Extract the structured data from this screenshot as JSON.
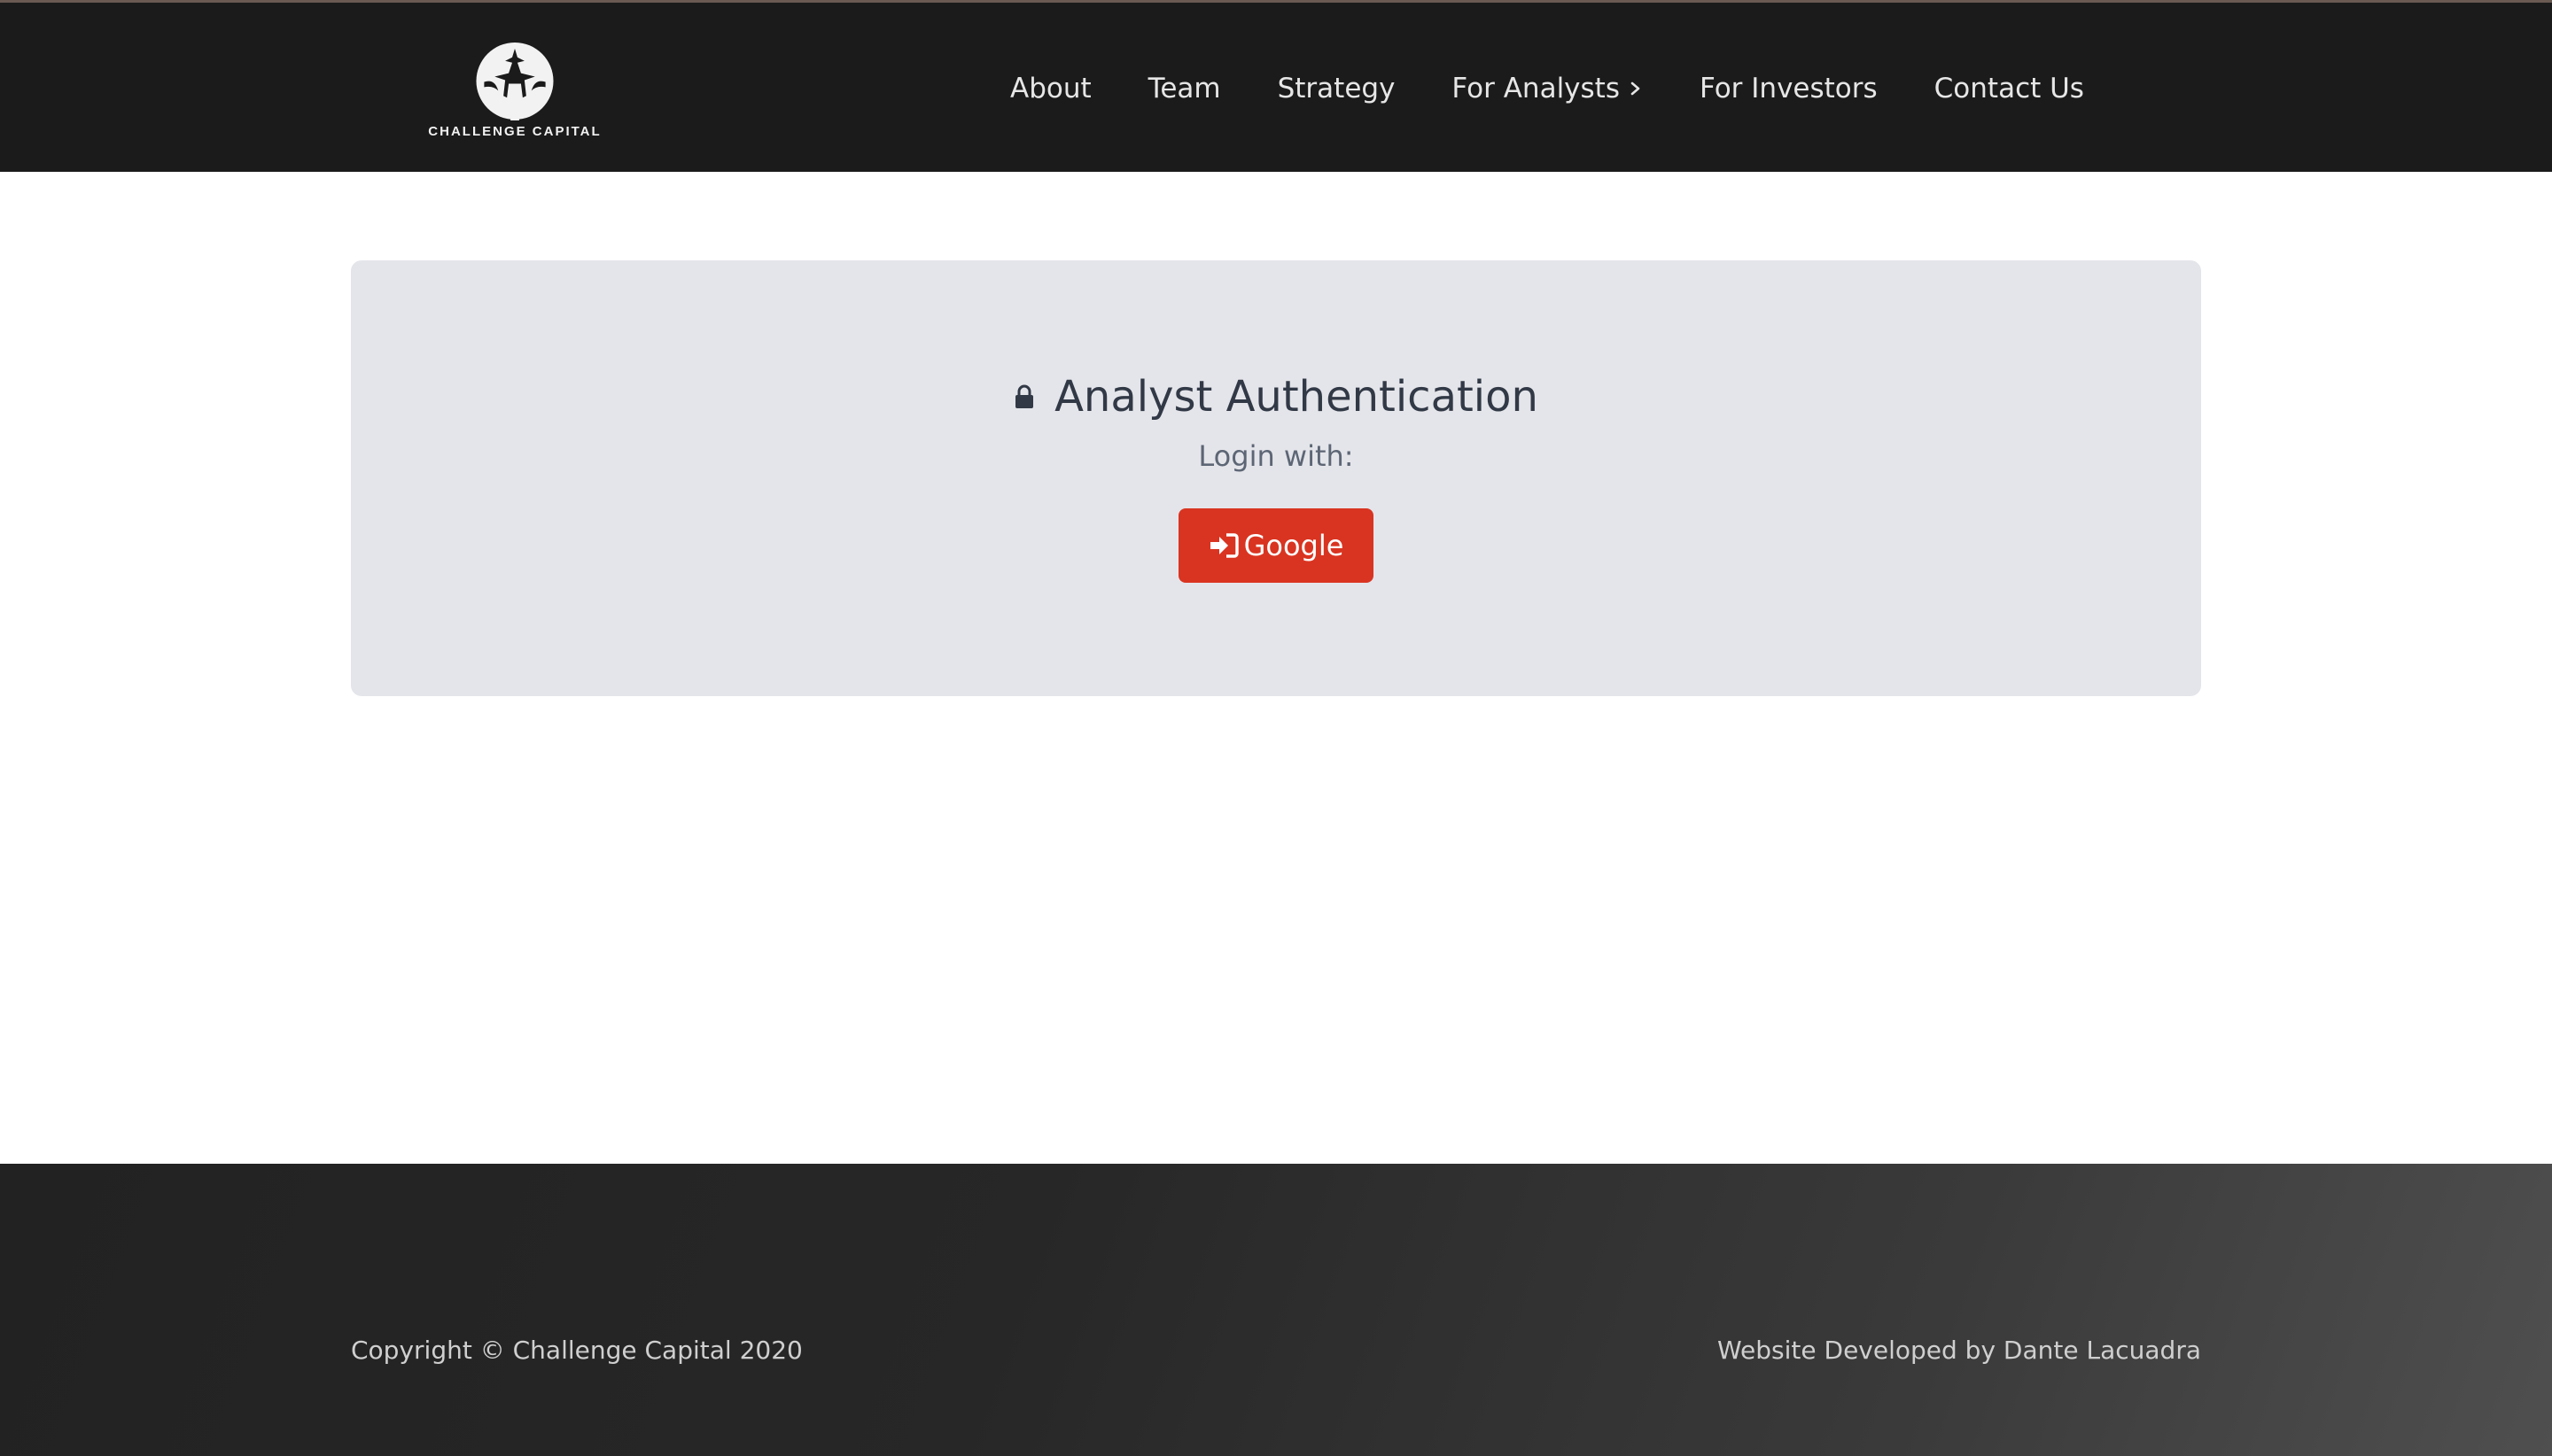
{
  "header": {
    "logo_text": "CHALLENGE CAPITAL",
    "nav": [
      {
        "label": "About"
      },
      {
        "label": "Team"
      },
      {
        "label": "Strategy"
      },
      {
        "label": "For Analysts",
        "icon": "chevron-right-icon"
      },
      {
        "label": "For Investors"
      },
      {
        "label": "Contact Us"
      }
    ]
  },
  "auth": {
    "title": "Analyst Authentication",
    "title_icon": "lock-icon",
    "subtitle": "Login with:",
    "google_button": {
      "label": "Google",
      "icon": "sign-in-icon"
    }
  },
  "footer": {
    "copyright": "Copyright © Challenge Capital 2020",
    "credit": "Website Developed by Dante Lacuadra"
  },
  "colors": {
    "header_bg": "#1b1b1b",
    "card_bg": "#e4e5ea",
    "google_red": "#d93421",
    "title_text": "#323946"
  }
}
